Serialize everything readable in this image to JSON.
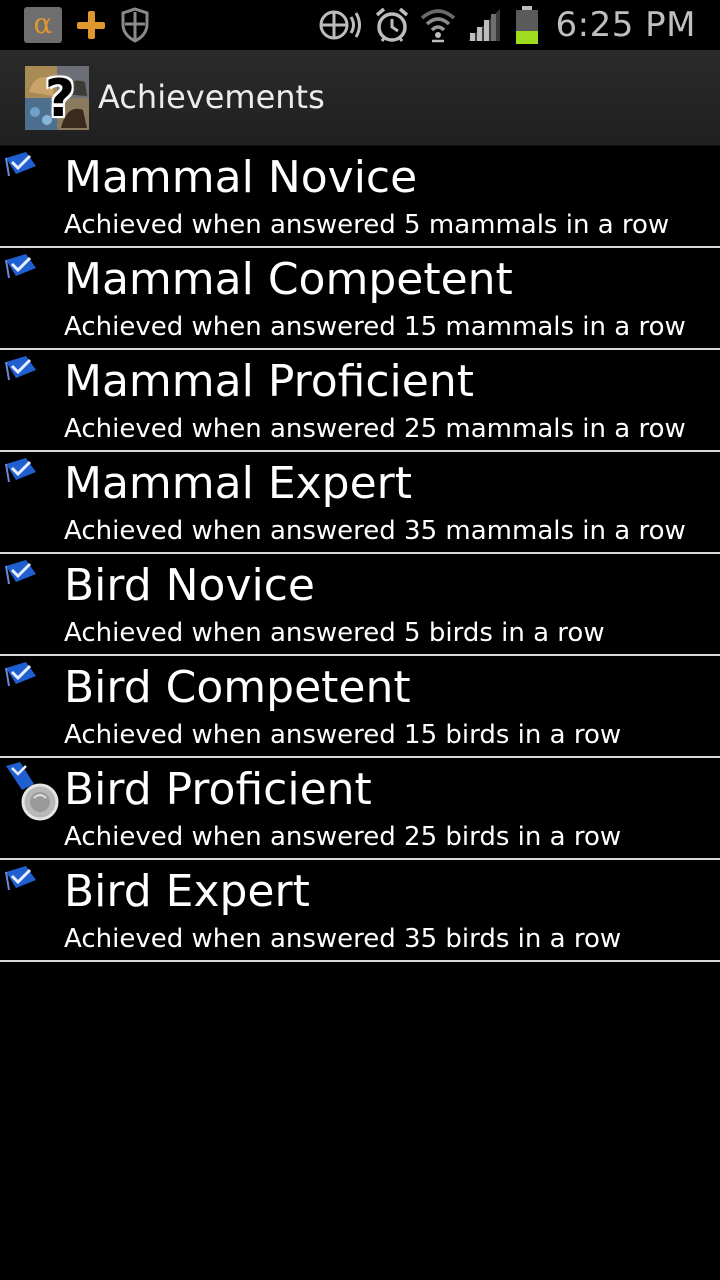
{
  "status_bar": {
    "time": "6:25 PM",
    "notification_icons": [
      "alpha-icon",
      "plus-icon",
      "shield-icon"
    ],
    "system_icons": [
      "nfc-icon",
      "alarm-icon",
      "wifi-icon",
      "signal-icon",
      "battery-icon"
    ],
    "battery_color": "#9fdc1f"
  },
  "app_bar": {
    "title": "Achievements",
    "icon": "quiz-app-icon"
  },
  "colors": {
    "background": "#000000",
    "divider": "#d8d8d8",
    "flag_blue": "#1f5fd0"
  },
  "achievements": [
    {
      "title": "Mammal Novice",
      "description": "Achieved when answered 5 mammals in a row",
      "badge": "blue-flag-icon"
    },
    {
      "title": "Mammal Competent",
      "description": "Achieved when answered 15 mammals in a row",
      "badge": "blue-flag-icon"
    },
    {
      "title": "Mammal Proficient",
      "description": "Achieved when answered 25 mammals in a row",
      "badge": "blue-flag-icon"
    },
    {
      "title": "Mammal Expert",
      "description": "Achieved when answered 35 mammals in a row",
      "badge": "blue-flag-icon"
    },
    {
      "title": "Bird Novice",
      "description": "Achieved when answered 5 birds in a row",
      "badge": "blue-flag-icon"
    },
    {
      "title": "Bird Competent",
      "description": "Achieved when answered 15 birds in a row",
      "badge": "blue-flag-icon"
    },
    {
      "title": "Bird Proficient",
      "description": "Achieved when answered 25 birds in a row",
      "badge": "silver-medal-icon"
    },
    {
      "title": "Bird Expert",
      "description": "Achieved when answered 35 birds in a row",
      "badge": "blue-flag-icon"
    }
  ]
}
